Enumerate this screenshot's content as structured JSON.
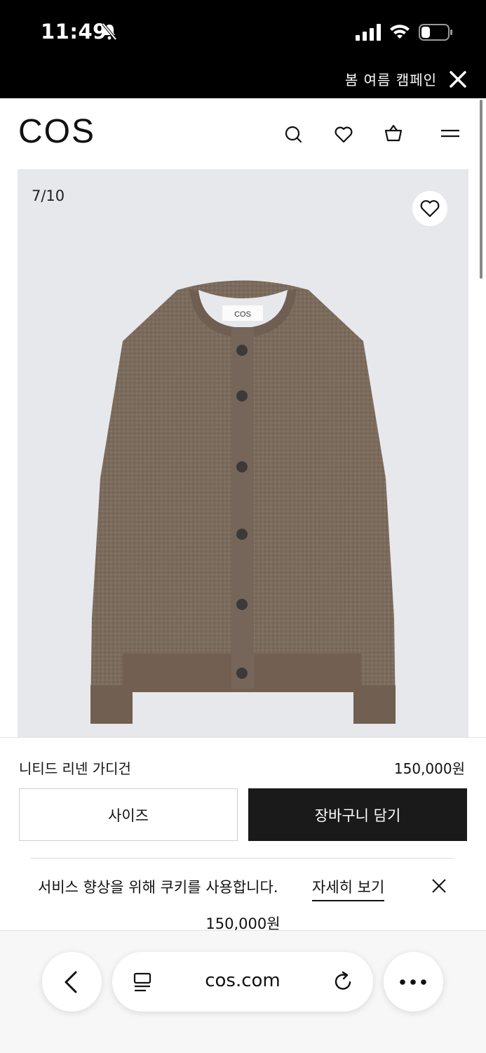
{
  "status_bar": {
    "time": "11:49"
  },
  "campaign_banner": {
    "text": "봄 여름 캠페인"
  },
  "header": {
    "logo": "COS"
  },
  "gallery": {
    "counter": "7/10",
    "label_tag": "COS"
  },
  "product": {
    "name": "니티드 리넨 가디건",
    "price": "150,000원",
    "size_label": "사이즈",
    "cart_label": "장바구니 담기"
  },
  "cookie": {
    "message": "서비스 향상을 위해 쿠키를 사용합니다.",
    "link": "자세히 보기"
  },
  "peek": {
    "price": "150,000원"
  },
  "browser": {
    "url": "cos.com"
  },
  "colors": {
    "cardigan": "#7b6b5c",
    "background": "#e7e8ec",
    "cart_button": "#1a1a1a"
  }
}
